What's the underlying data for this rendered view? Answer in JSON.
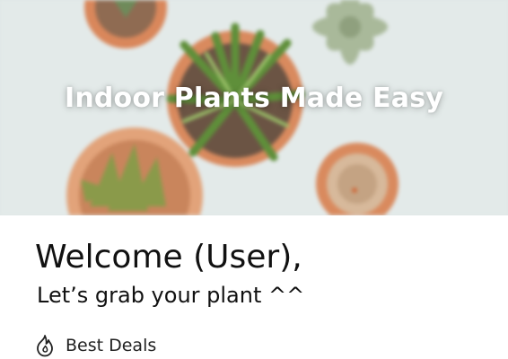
{
  "hero": {
    "title": "Indoor Plants Made Easy"
  },
  "greeting": {
    "welcome": "Welcome (User),",
    "subtitle": "Let’s grab your plant ^^"
  },
  "sections": [
    {
      "label": "Best Deals",
      "icon": "flame-icon"
    }
  ]
}
